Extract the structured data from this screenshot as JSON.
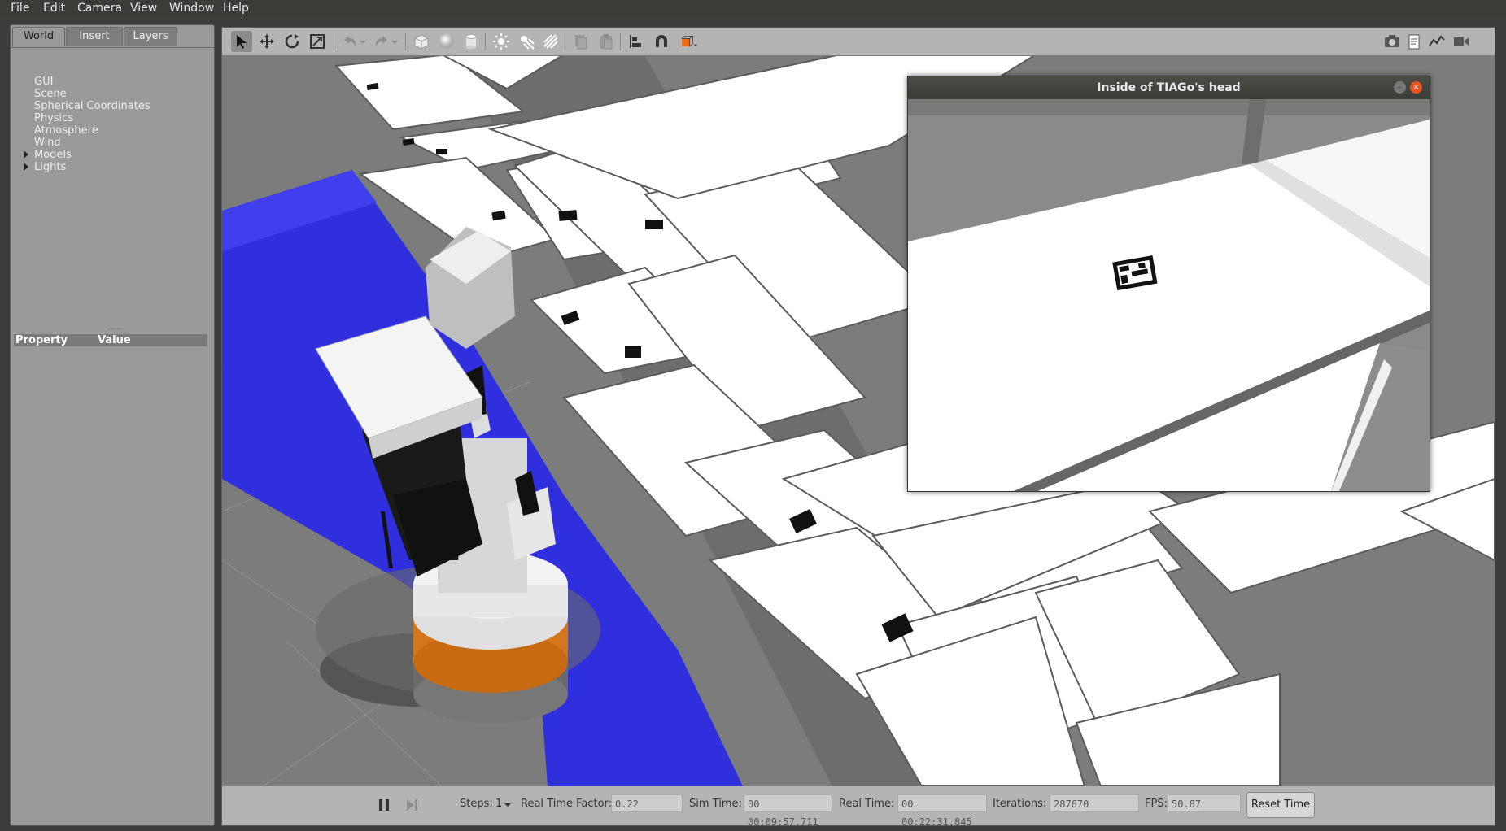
{
  "menu": [
    "File",
    "Edit",
    "Camera",
    "View",
    "Window",
    "Help"
  ],
  "left_panel": {
    "tabs": [
      "World",
      "Insert",
      "Layers"
    ],
    "tree": [
      "GUI",
      "Scene",
      "Spherical Coordinates",
      "Physics",
      "Atmosphere",
      "Wind",
      "Models",
      "Lights"
    ],
    "property_header": {
      "property": "Property",
      "value": "Value"
    }
  },
  "toolbar": {
    "left_icons": [
      "select-arrow-icon",
      "translate-icon",
      "rotate-icon",
      "scale-icon",
      "undo-icon",
      "undo-dropdown-icon",
      "redo-icon",
      "redo-dropdown-icon",
      "box-icon",
      "sphere-icon",
      "cylinder-icon",
      "point-light-icon",
      "spot-light-icon",
      "directional-light-icon",
      "copy-icon",
      "paste-icon",
      "align-icon",
      "magnet-snap-icon",
      "view-angle-icon"
    ],
    "right_icons": [
      "screenshot-icon",
      "log-icon",
      "plot-icon",
      "video-record-icon"
    ]
  },
  "camera_window": {
    "title": "Inside of TIAGo's head"
  },
  "bottom_bar": {
    "steps_label": "Steps:",
    "steps_value": "1",
    "rtf_label": "Real Time Factor:",
    "rtf_value": "0.22",
    "sim_time_label": "Sim Time:",
    "sim_time_value": "00 00:09:57.711",
    "real_time_label": "Real Time:",
    "real_time_value": "00 00:22:31.845",
    "iterations_label": "Iterations:",
    "iterations_value": "287670",
    "fps_label": "FPS:",
    "fps_value": "50.87",
    "reset_label": "Reset Time"
  },
  "colors": {
    "laser_blue": "#2222ee",
    "robot_orange": "#d4761c",
    "menubar": "#3c3b37",
    "close_button": "#e95420"
  }
}
